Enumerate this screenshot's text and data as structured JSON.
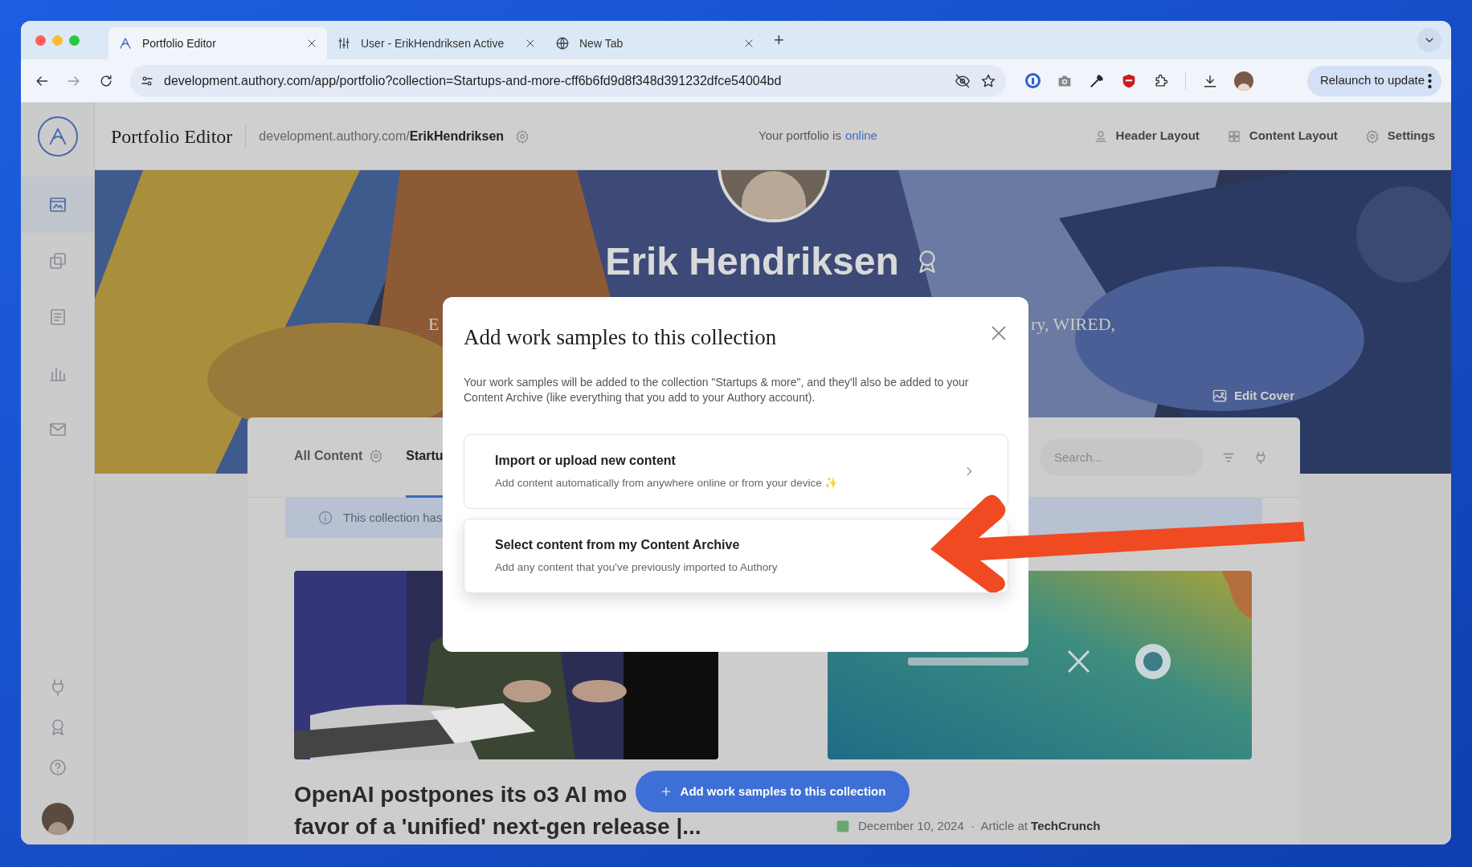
{
  "browser": {
    "tabs": [
      {
        "title": "Portfolio Editor",
        "kind": "app",
        "selected": true
      },
      {
        "title": "User - ErikHendriksen Active",
        "kind": "admin",
        "selected": false
      },
      {
        "title": "New Tab",
        "kind": "newtab",
        "selected": false
      }
    ],
    "new_tab": "+",
    "url": "development.authory.com/app/portfolio?collection=Startups-and-more-cff6b6fd9d8f348d391232dfce54004bd",
    "relaunch": "Relaunch to update"
  },
  "sidebar": {
    "items": [
      {
        "kind": "portfolio",
        "selected": true
      },
      {
        "kind": "copy",
        "selected": false
      },
      {
        "kind": "list",
        "selected": false
      },
      {
        "kind": "chart",
        "selected": false
      },
      {
        "kind": "mail",
        "selected": false
      }
    ],
    "bottom_items": [
      {
        "kind": "plug"
      },
      {
        "kind": "award"
      },
      {
        "kind": "help"
      },
      {
        "kind": "avatar"
      }
    ]
  },
  "header": {
    "title": "Portfolio Editor",
    "url": "development.authory.com/**ErikHendriksen**",
    "status_prefix": "Your portfolio is",
    "status_link": "online",
    "actions": [
      {
        "kind": "person",
        "label": "Header Layout"
      },
      {
        "kind": "grid",
        "label": "Content Layout"
      },
      {
        "kind": "gear",
        "label": "Settings"
      }
    ]
  },
  "cover": {
    "name": "Erik Hendriksen",
    "bio_left": "E",
    "bio_right": "ry, WIRED,",
    "edit": "Edit Cover"
  },
  "content": {
    "tabs": [
      {
        "label": "All Content",
        "selected": false
      },
      {
        "label": "Startu",
        "selected": true
      }
    ],
    "search_placeholder": "Search...",
    "notice": "This collection has",
    "cards": [
      {
        "kind": "people",
        "title_lines": [
          "OpenAI postpones its o3 AI mo",
          "favor of a 'unified' next-gen release |..."
        ]
      },
      {
        "kind": "logos",
        "meta": "December 10, 2024  ·  Article at **TechCrunch**"
      }
    ]
  },
  "fab": {
    "label": "Add work samples to this collection"
  },
  "modal": {
    "title": "Add work samples to this collection",
    "body": "Your work samples will be added to the collection \"Startups & more\", and they'll also be added to your Content Archive (like everything that you add to your Authory account).",
    "options": [
      {
        "title": "Import or upload new content",
        "description": "Add content automatically from anywhere online or from your device ✨",
        "kind": "import",
        "highlighted": false
      },
      {
        "title": "Select content from my Content Archive",
        "description": "Add any content that you've previously imported to Authory",
        "kind": "archive",
        "highlighted": true
      }
    ]
  }
}
